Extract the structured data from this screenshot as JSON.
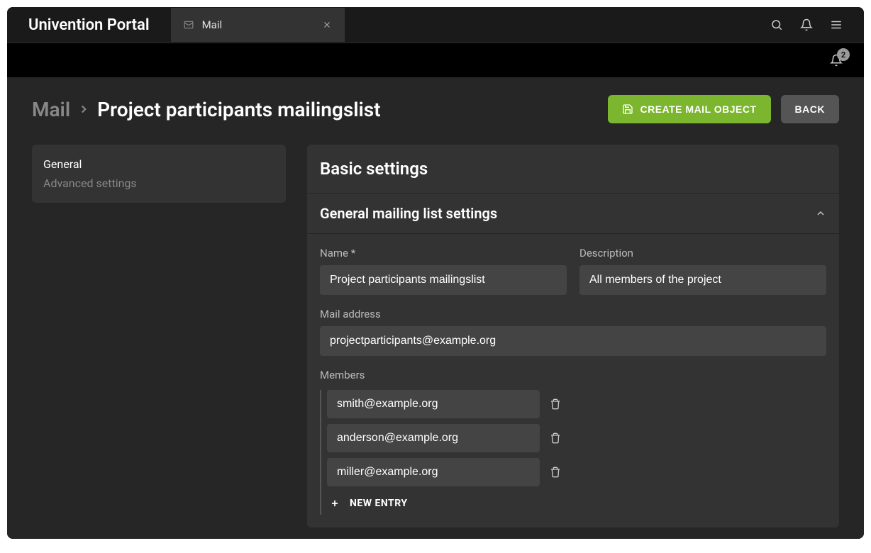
{
  "portal": {
    "title": "Univention Portal"
  },
  "tab": {
    "label": "Mail"
  },
  "notifications": {
    "count": "2"
  },
  "breadcrumb": {
    "root": "Mail",
    "current": "Project participants mailingslist"
  },
  "actions": {
    "create_label": "CREATE MAIL OBJECT",
    "back_label": "BACK"
  },
  "sidebar": {
    "items": [
      {
        "label": "General",
        "active": true
      },
      {
        "label": "Advanced settings",
        "active": false
      }
    ]
  },
  "panel": {
    "title": "Basic settings",
    "section_title": "General mailing list settings",
    "fields": {
      "name_label": "Name *",
      "name_value": "Project participants mailingslist",
      "description_label": "Description",
      "description_value": "All members of the project",
      "mail_label": "Mail address",
      "mail_value": "projectparticipants@example.org",
      "members_label": "Members"
    },
    "members": [
      "smith@example.org",
      "anderson@example.org",
      "miller@example.org"
    ],
    "new_entry_label": "NEW ENTRY"
  }
}
